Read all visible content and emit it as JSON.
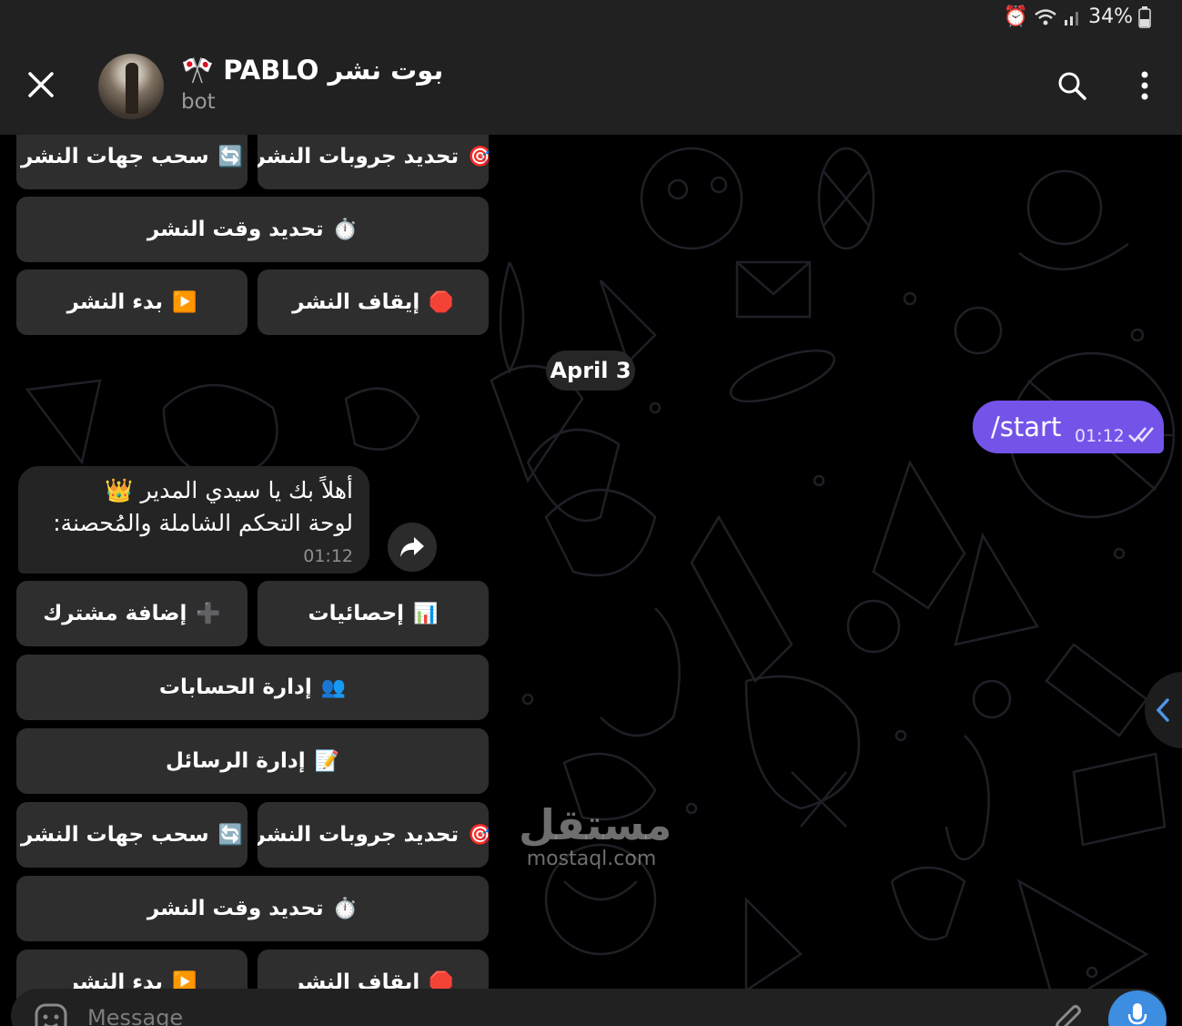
{
  "status_bar": {
    "battery": "34%",
    "icons": [
      "alarm-icon",
      "wifi-icon",
      "signal-icon",
      "battery-icon"
    ]
  },
  "header": {
    "title": "🎌 PABLO بوت نشر",
    "subtitle": "bot"
  },
  "keyboard_top": {
    "row1": [
      {
        "label": "تحديد جروبات النشر",
        "icon": "🎯"
      },
      {
        "label": "سحب جهات النشر",
        "icon": "🔄"
      }
    ],
    "row2": {
      "label": "تحديد وقت النشر",
      "icon": "⏱️"
    },
    "row3": [
      {
        "label": "إيقاف النشر",
        "icon": "🛑"
      },
      {
        "label": "بدء النشر",
        "icon": "▶️"
      }
    ]
  },
  "date_label": "April 3",
  "outgoing": {
    "text": "/start",
    "time": "01:12"
  },
  "incoming": {
    "line1": "أهلاً بك يا سيدي المدير 👑",
    "line2": "لوحة التحكم الشاملة والمُحصنة:",
    "time": "01:12"
  },
  "keyboard_bottom": {
    "row1": [
      {
        "label": "إحصائيات",
        "icon": "📊"
      },
      {
        "label": "إضافة مشترك",
        "icon": "➕"
      }
    ],
    "row2": {
      "label": "إدارة الحسابات",
      "icon": "👥"
    },
    "row3": {
      "label": "إدارة الرسائل",
      "icon": "📝"
    },
    "row4": [
      {
        "label": "تحديد جروبات النشر",
        "icon": "🎯"
      },
      {
        "label": "سحب جهات النشر",
        "icon": "🔄"
      }
    ],
    "row5": {
      "label": "تحديد وقت النشر",
      "icon": "⏱️"
    },
    "row6": [
      {
        "label": "إيقاف النشر",
        "icon": "🛑"
      },
      {
        "label": "بدء النشر",
        "icon": "▶️"
      }
    ]
  },
  "watermark": {
    "arabic": "مستقل",
    "latin": "mostaql.com"
  },
  "composer": {
    "placeholder": "Message"
  },
  "colors": {
    "accent_purple": "#7454e8",
    "mic_blue": "#3d8de0",
    "header_bg": "#212121",
    "button_bg": "#303030"
  }
}
